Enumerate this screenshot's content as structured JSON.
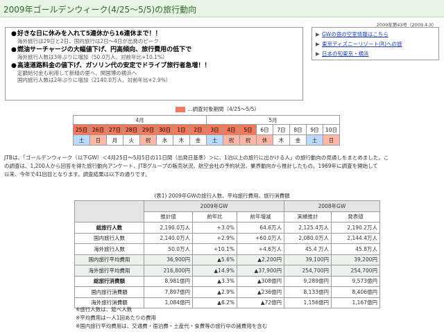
{
  "header": {
    "title": "2009年ゴールデンウィーク(4/25〜5/5)の旅行動向",
    "issue": "2009年第43号（2009.4.3）"
  },
  "summary": [
    {
      "head": "好きな日に休みを入れて5連休から16連休まで！！",
      "subs": [
        "海外旅行は29日と2日、国内旅行は2日〜4日が出発のピーク"
      ]
    },
    {
      "head": "燃油サーチャージの大幅値下げ、円高傾向、旅行費用の低下で",
      "subs": [
        "海外旅行人数は3年ぶりに増加（50.0万人、対前年比+10.1%）"
      ]
    },
    {
      "head": "高速道路料金の値下げ、ガソリン代の安定でドライブ旅行者急増！！",
      "subs": [
        "定額給付金も利用して新緑の里へ、関国博の横浜へ",
        "国内旅行人数は2年ぶりに増加（2140.0万人、対前年比+2.9%）"
      ]
    }
  ],
  "bullet_glyph": "●",
  "links": {
    "arrow": "▶",
    "items": [
      "GWの宿の空室情報はこちら",
      "東京ディズニーリゾート(R)への旅",
      "日本の旬東京・横浜"
    ]
  },
  "legend": {
    "label": "…調査対象期間（4/25〜5/5）"
  },
  "calendar": {
    "months": [
      "4月",
      "5月"
    ],
    "dates": [
      "25日",
      "26日",
      "27日",
      "28日",
      "29日",
      "30日",
      "1日",
      "2日",
      "3日",
      "4日",
      "5日",
      "6日",
      "7日",
      "8日",
      "9日",
      "10日"
    ],
    "days": [
      "土",
      "日",
      "月",
      "火",
      "祝",
      "水",
      "木",
      "金",
      "土",
      "祝",
      "祝",
      "休",
      "木",
      "金",
      "土",
      "日"
    ],
    "in_period": [
      true,
      true,
      true,
      true,
      true,
      true,
      true,
      true,
      true,
      true,
      true,
      false,
      false,
      false,
      false,
      false
    ],
    "highlight_color": "#f27a5a"
  },
  "intro": [
    "JTBは、「ゴールデンウィーク（以下GW）＜4月25日〜5月5日の11日間（出発日基準）＞に、1泊以上の旅行に出かける人」の旅行動向の見通しをまとめました。こ",
    "の調査は、1,200人から回答を得た旅行動向アンケート、JTBグループの販売状況、航空会社の予約状況、業界動向から推計したもの。1969年に調査を開始して",
    "以来、今年で41回目となります。調査結果は以下の通りです。"
  ],
  "table": {
    "caption": "(表1) 2009年GWの旅行人数、平均旅行費用、旅行消費額",
    "group_headers": [
      "2009年GW",
      "2008年GW"
    ],
    "col_headers": [
      "推計値",
      "前年比",
      "前年増減",
      "実績推計",
      "発表値"
    ],
    "rows": [
      {
        "label": "総旅行人数",
        "bold": true,
        "shade": false,
        "values": [
          "2,190.0万人",
          "+3.0%",
          "64.6万人",
          "2,125.4万人",
          "2,190.2万人"
        ]
      },
      {
        "label": "国内旅行人数",
        "bold": false,
        "shade": false,
        "values": [
          "2,140.0万人",
          "+2.9%",
          "+60.0万人",
          "2,080.0万人",
          "2,144.4万人"
        ]
      },
      {
        "label": "海外旅行人数",
        "bold": false,
        "shade": false,
        "values": [
          "50.0万人",
          "+10.1%",
          "+4.6万人",
          "45.4 万人",
          "45.8万人"
        ]
      },
      {
        "label": "国内旅行平均費用",
        "bold": false,
        "shade": true,
        "values": [
          "36,900円",
          "▲5.6%",
          "▲2,200円",
          "39,100円",
          "39,200円"
        ]
      },
      {
        "label": "海外旅行平均費用",
        "bold": false,
        "shade": true,
        "values": [
          "216,800円",
          "▲14.9%",
          "▲37,900円",
          "254,700円",
          "254,700円"
        ]
      },
      {
        "label": "総旅行消費額",
        "bold": true,
        "shade": false,
        "values": [
          "8,981億円",
          "▲3.3%",
          "▲308億円",
          "9,289億円",
          "9,573億円"
        ]
      },
      {
        "label": "国内旅行消費額",
        "bold": false,
        "shade": false,
        "values": [
          "7,897億円",
          "▲2.9%",
          "▲236億円",
          "8,133億円",
          "8,406億円"
        ]
      },
      {
        "label": "海外旅行消費額",
        "bold": false,
        "shade": false,
        "values": [
          "1,084億円",
          "▲6.2%",
          "▲72億円",
          "1,156億円",
          "1,167億円"
        ]
      }
    ]
  },
  "notes": [
    "※旅行人数は、延べ人数",
    "※平均費用は一人1回あたりの費用",
    "※国内旅行平均費用は、交通費・宿泊費・土産代・食費等の旅行中の諸費用を含む"
  ]
}
